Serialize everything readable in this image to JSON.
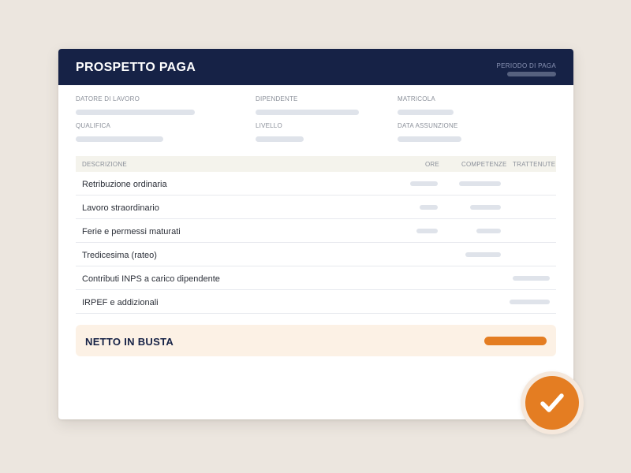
{
  "header": {
    "title": "PROSPETTO PAGA",
    "period_label": "PERIODO DI PAGA"
  },
  "info": {
    "employer_label": "DATORE DI LAVORO",
    "employee_label": "DIPENDENTE",
    "id_label": "MATRICOLA",
    "qualification_label": "QUALIFICA",
    "level_label": "LIVELLO",
    "hire_date_label": "DATA ASSUNZIONE"
  },
  "table": {
    "columns": [
      "DESCRIZIONE",
      "ORE",
      "COMPETENZE",
      "TRATTENUTE"
    ],
    "rows": [
      {
        "label": "Retribuzione ordinaria"
      },
      {
        "label": "Lavoro straordinario"
      },
      {
        "label": "Ferie e permessi maturati"
      },
      {
        "label": "Tredicesima (rateo)"
      },
      {
        "label": "Contributi INPS a carico dipendente"
      },
      {
        "label": "IRPEF e addizionali"
      }
    ]
  },
  "net": {
    "label": "NETTO IN BUSTA"
  },
  "icons": {
    "verified": "checkmark-icon"
  },
  "colors": {
    "header": "#162246",
    "accent": "#e47d22",
    "placeholder": "#dfe3ea"
  }
}
